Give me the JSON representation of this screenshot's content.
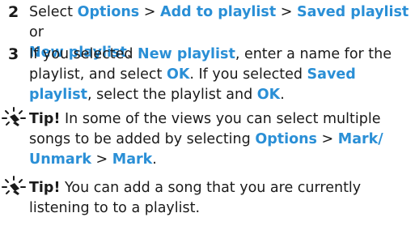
{
  "step2": {
    "number": "2",
    "t1": "Select ",
    "k1": "Options",
    "s1": " > ",
    "k2": "Add to playlist",
    "s2": " > ",
    "k3": "Saved playlist",
    "t2": " or",
    "k4": "New playlist",
    "t3": "."
  },
  "step3": {
    "number": "3",
    "t1": "If you selected ",
    "k1": "New playlist",
    "t2": ", enter a name for the playlist, and select ",
    "k2": "OK",
    "t3": ". If you selected ",
    "k3": "Saved playlist",
    "t4": ", select the playlist and ",
    "k4": "OK",
    "t5": "."
  },
  "tip1": {
    "label": "Tip!",
    "t1": " In some of the views you can select multiple songs to be added by selecting ",
    "k1": "Options",
    "s1": " > ",
    "k2": "Mark/ Unmark",
    "s2": "  > ",
    "k3": "Mark",
    "t2": "."
  },
  "tip2": {
    "label": "Tip!",
    "t1": " You can add a song that you are currently listening to to a playlist."
  },
  "colors": {
    "keyword": "#2a8fd6",
    "text": "#1a1a1a"
  },
  "icons": {
    "tip": "lightbulb-icon"
  }
}
